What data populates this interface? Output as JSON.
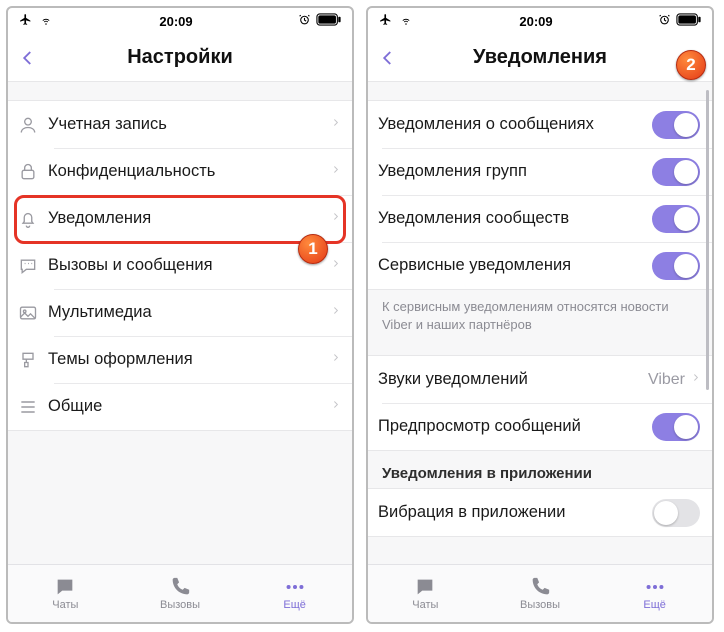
{
  "status": {
    "time": "20:09"
  },
  "screens": {
    "settings": {
      "title": "Настройки",
      "items": [
        {
          "label": "Учетная запись"
        },
        {
          "label": "Конфиденциальность"
        },
        {
          "label": "Уведомления"
        },
        {
          "label": "Вызовы и сообщения"
        },
        {
          "label": "Мультимедиа"
        },
        {
          "label": "Темы оформления"
        },
        {
          "label": "Общие"
        }
      ]
    },
    "notifications": {
      "title": "Уведомления",
      "toggles": [
        {
          "label": "Уведомления о сообщениях"
        },
        {
          "label": "Уведомления групп"
        },
        {
          "label": "Уведомления сообществ"
        },
        {
          "label": "Сервисные уведомления"
        }
      ],
      "footer": "К сервисным уведомлениям относятся новости Viber и наших партнёров",
      "sounds": {
        "label": "Звуки уведомлений",
        "value": "Viber"
      },
      "preview": {
        "label": "Предпросмотр сообщений"
      },
      "section_header": "Уведомления в приложении",
      "vibration": {
        "label": "Вибрация в приложении"
      }
    }
  },
  "tabs": {
    "chats": "Чаты",
    "calls": "Вызовы",
    "more": "Ещё"
  },
  "badges": {
    "one": "1",
    "two": "2"
  }
}
